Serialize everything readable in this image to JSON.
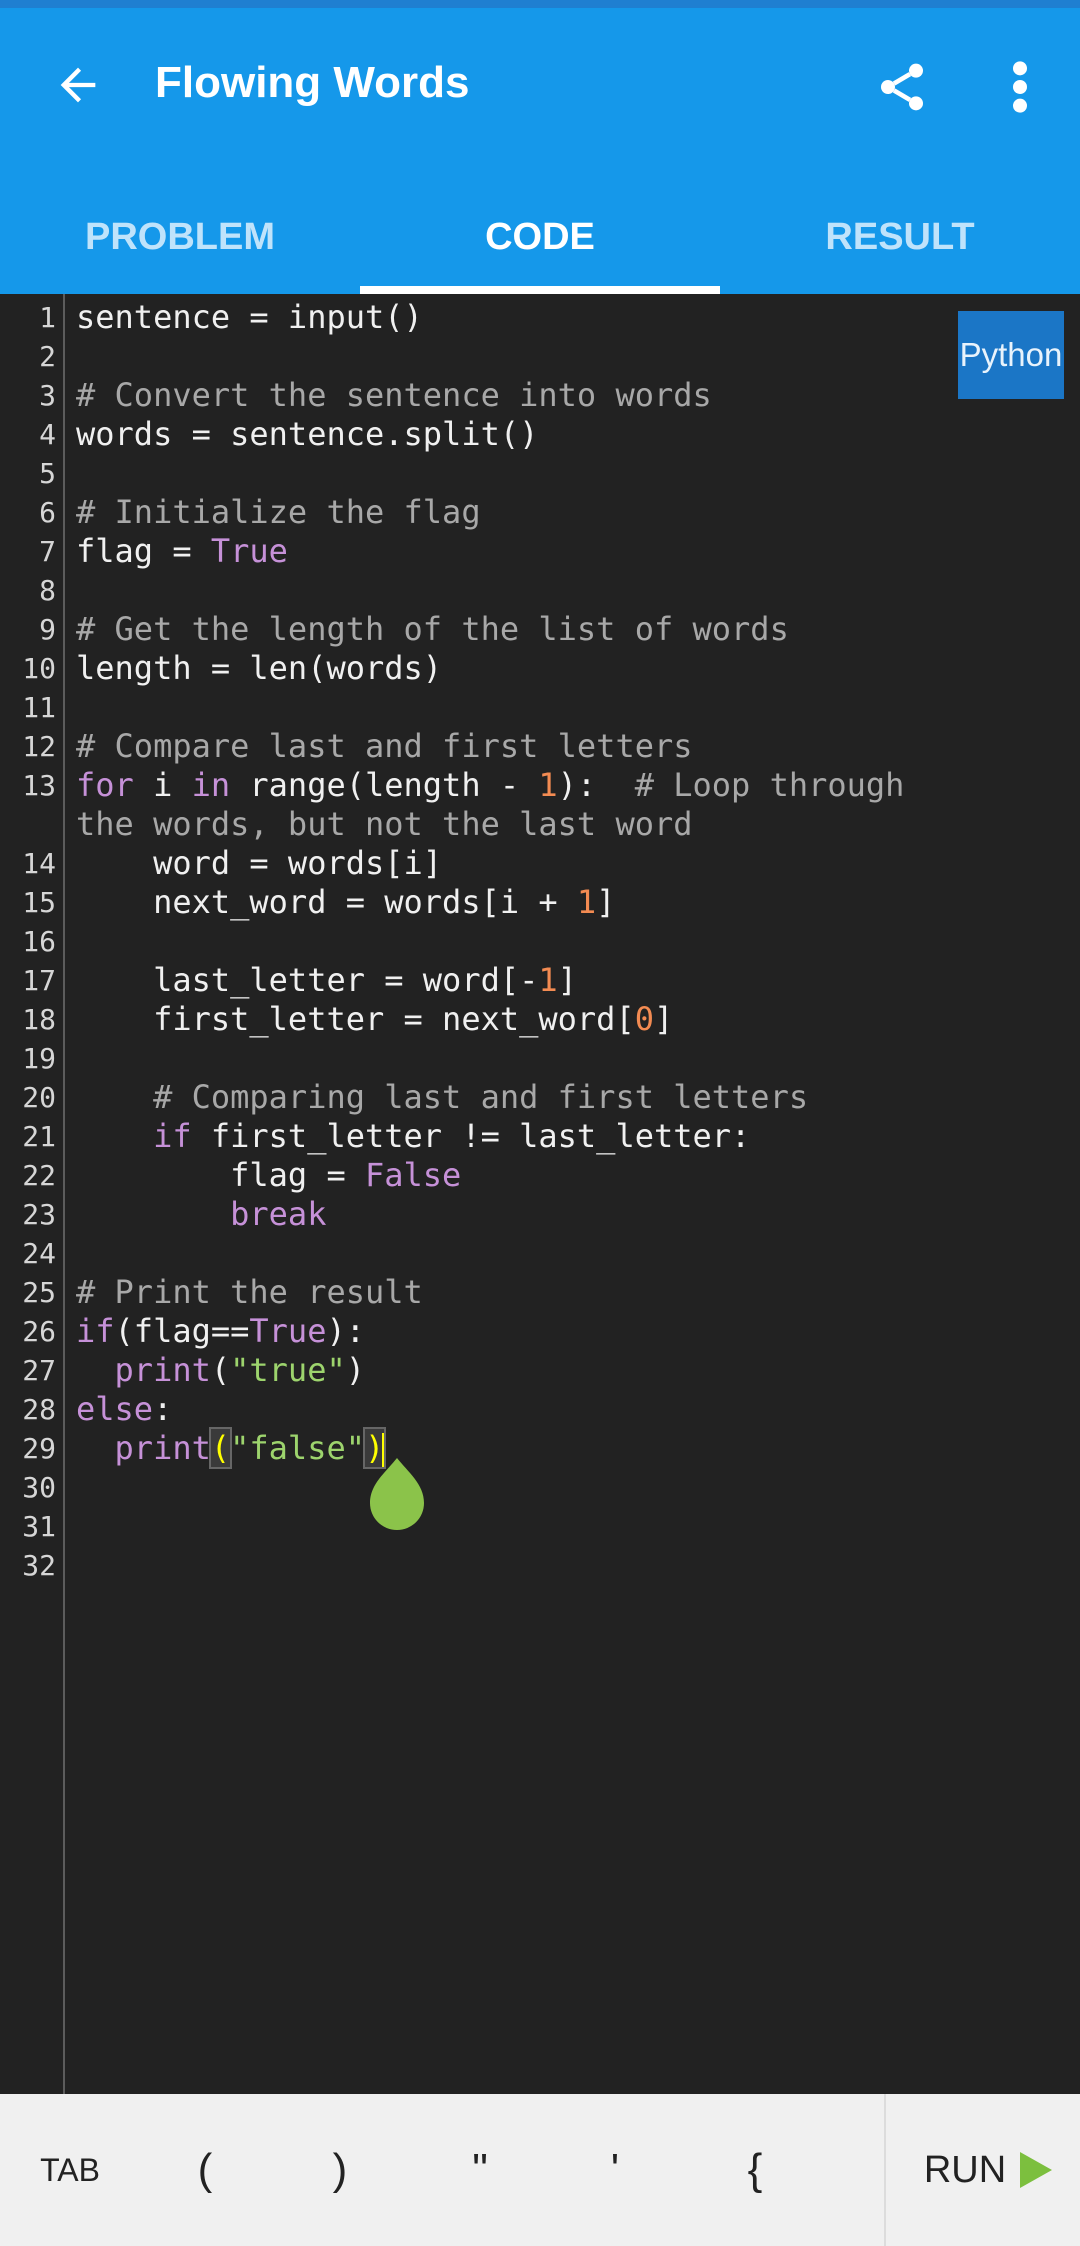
{
  "app": {
    "title": "Flowing Words",
    "icons": {
      "back": "arrow-left-icon",
      "share": "share-icon",
      "more": "more-vert-icon",
      "run": "play-icon"
    }
  },
  "tabs": [
    {
      "label": "PROBLEM",
      "active": false
    },
    {
      "label": "CODE",
      "active": true
    },
    {
      "label": "RESULT",
      "active": false
    }
  ],
  "editor": {
    "language": "Python",
    "line_numbers": [
      "1",
      "2",
      "3",
      "4",
      "5",
      "6",
      "7",
      "8",
      "9",
      "10",
      "11",
      "12",
      "13",
      "14",
      "15",
      "16",
      "17",
      "18",
      "19",
      "20",
      "21",
      "22",
      "23",
      "24",
      "25",
      "26",
      "27",
      "28",
      "29",
      "30",
      "31",
      "32"
    ],
    "lines": [
      "sentence = input()",
      "",
      "# Convert the sentence into words",
      "words = sentence.split()",
      "",
      "# Initialize the flag",
      "flag = True",
      "",
      "# Get the length of the list of words",
      "length = len(words)",
      "",
      "# Compare last and first letters",
      "for i in range(length - 1):  # Loop through the words, but not the last word",
      "    word = words[i]",
      "    next_word = words[i + 1]",
      "",
      "    last_letter = word[-1]",
      "    first_letter = next_word[0]",
      "",
      "    # Comparing last and first letters",
      "    if first_letter != last_letter:",
      "        flag = False",
      "        break",
      "",
      "# Print the result",
      "if(flag==True):",
      "  print(\"true\")",
      "else:",
      "  print(\"false\")",
      "",
      "",
      ""
    ]
  },
  "keys": [
    "TAB",
    "(",
    ")",
    "\"",
    "'",
    "{"
  ],
  "run_label": "RUN",
  "colors": {
    "appbar": "#1598ea",
    "editor_bg": "#222222",
    "keyword": "#c691d8",
    "number": "#f38b52",
    "string": "#9dd46d",
    "comment": "#a8a8a8",
    "cursor": "#ffff00",
    "handle": "#8bc34a",
    "language_badge": "#1b76c6"
  }
}
